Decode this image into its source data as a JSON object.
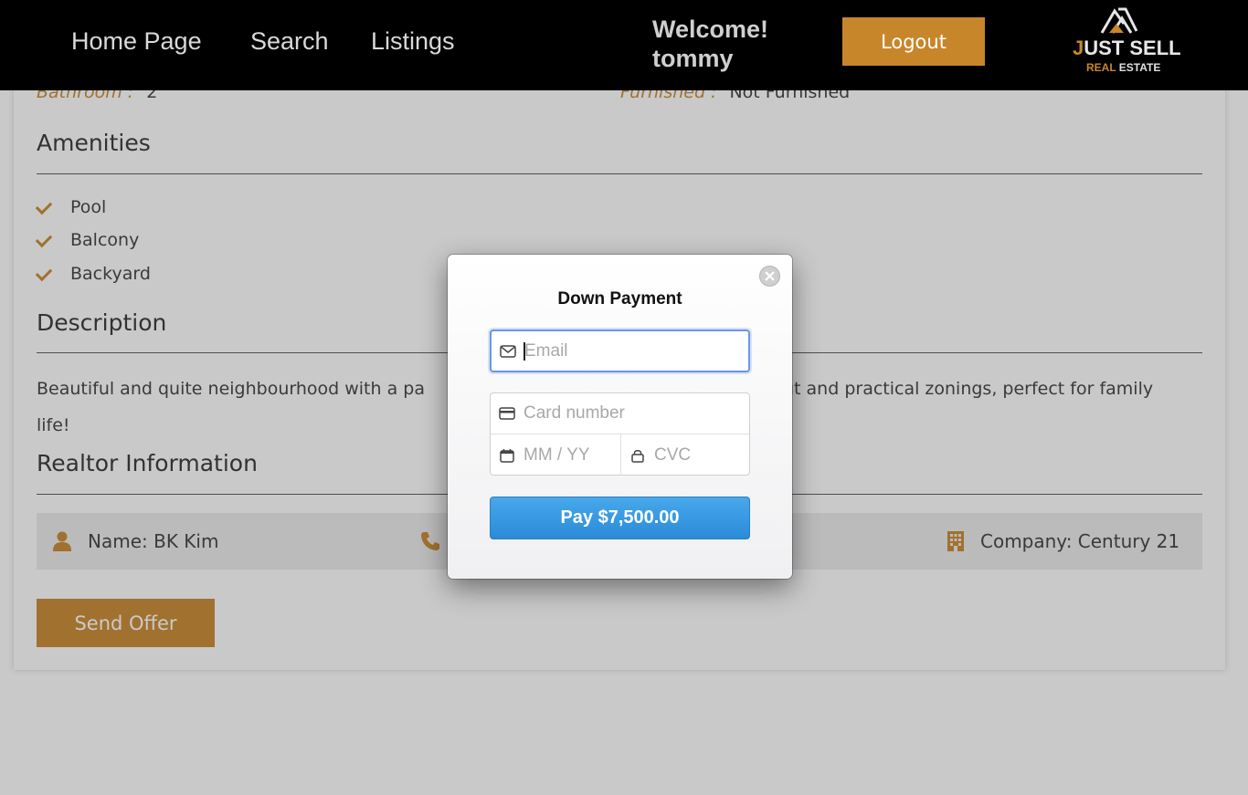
{
  "navbar": {
    "links": [
      "Home Page",
      "Search",
      "Listings"
    ],
    "welcome_line1": "Welcome!",
    "welcome_line2": "tommy",
    "logout_label": "Logout",
    "logo": {
      "main_j": "J",
      "main_rest": "UST SELL",
      "sub_real": "REAL",
      "sub_estate": " ESTATE"
    }
  },
  "details": {
    "bathroom_key": "Bathroom :",
    "bathroom_val": "2",
    "furnished_key": "Furnished :",
    "furnished_val": "Not Furnished"
  },
  "amenities": {
    "title": "Amenities",
    "items": [
      "Pool",
      "Balcony",
      "Backyard"
    ]
  },
  "description": {
    "title": "Description",
    "text_left": "Beautiful and quite neighbourhood with a pa",
    "text_right": "ut and practical zonings, perfect for family",
    "text_line2": "life!"
  },
  "realtor": {
    "title": "Realtor Information",
    "name": "Name: BK Kim",
    "company": "Company: Century 21"
  },
  "send_offer_label": "Send Offer",
  "modal": {
    "title": "Down Payment",
    "email_placeholder": "Email",
    "card_placeholder": "Card number",
    "exp_placeholder": "MM / YY",
    "cvc_placeholder": "CVC",
    "pay_label": "Pay $7,500.00"
  },
  "colors": {
    "accent": "#c8862a",
    "pay_blue": "#3597e0",
    "navbar": "#000000"
  }
}
